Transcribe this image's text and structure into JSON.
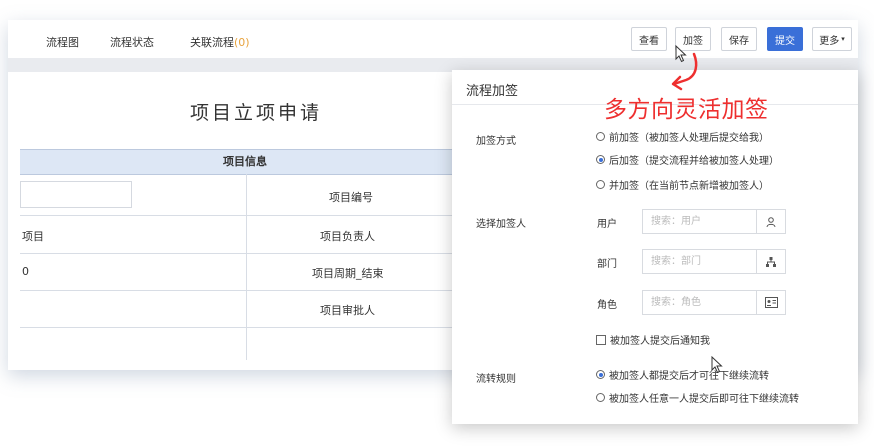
{
  "tabs": [
    {
      "label": "流程图"
    },
    {
      "label": "流程状态"
    },
    {
      "label": "关联流程",
      "count": "(0)"
    }
  ],
  "toolbar": {
    "view_label": "查看",
    "countersign_label": "加签",
    "save_label": "保存",
    "submit_label": "提交",
    "more_label": "更多"
  },
  "form": {
    "title": "项目立项申请",
    "section_title": "项目信息",
    "left_cells": [
      "项目",
      "0"
    ],
    "field_labels": [
      "项目编号",
      "项目负责人",
      "项目周期_结束",
      "项目审批人"
    ]
  },
  "annotation": {
    "text": "多方向灵活加签",
    "color": "#ee2f2f"
  },
  "dialog": {
    "title": "流程加签",
    "method_label": "加签方式",
    "method_options": [
      {
        "label": "前加签（被加签人处理后提交给我）",
        "checked": false
      },
      {
        "label": "后加签（提交流程并给被加签人处理）",
        "checked": true
      },
      {
        "label": "并加签（在当前节点新增被加签人）",
        "checked": false
      }
    ],
    "select_label": "选择加签人",
    "pickers": [
      {
        "label": "用户",
        "placeholder": "搜索：用户",
        "icon": "user-icon"
      },
      {
        "label": "部门",
        "placeholder": "搜索：部门",
        "icon": "org-chart-icon"
      },
      {
        "label": "角色",
        "placeholder": "搜索：角色",
        "icon": "id-card-icon"
      }
    ],
    "notify_label": "被加签人提交后通知我",
    "notify_checked": false,
    "flow_label": "流转规则",
    "flow_options": [
      {
        "label": "被加签人都提交后才可往下继续流转",
        "checked": true
      },
      {
        "label": "被加签人任意一人提交后即可往下继续流转",
        "checked": false
      }
    ]
  },
  "colors": {
    "primary": "#3a6fd8",
    "header_bg": "#dde7f5",
    "count": "#e8a33d"
  }
}
